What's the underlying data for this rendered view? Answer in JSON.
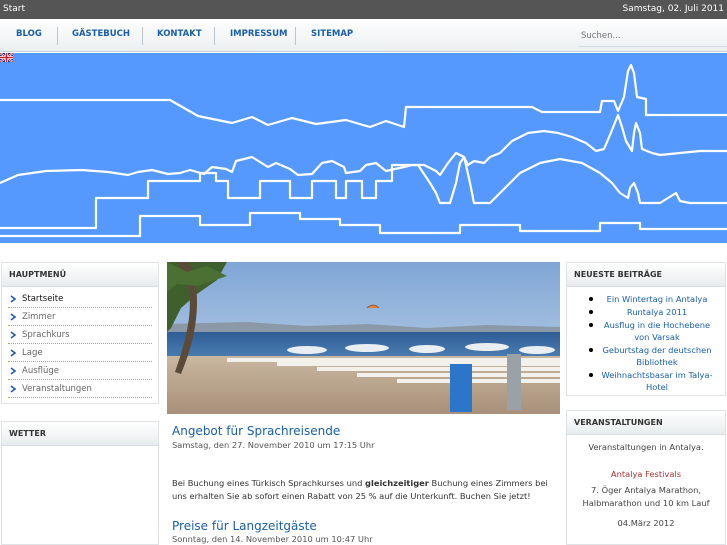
{
  "topbar": {
    "breadcrumb": "Start",
    "date": "Samstag, 02. Juli 2011"
  },
  "nav": {
    "items": [
      "BLOG",
      "GÄSTEBUCH",
      "KONTAKT",
      "IMPRESSUM",
      "SITEMAP"
    ],
    "search_placeholder": "Suchen..."
  },
  "colors": {
    "banner": "#5599ff",
    "link": "#1a5fa8",
    "accent_green": "#8fbf4a",
    "event_link": "#aa3333"
  },
  "languages": [
    "de-flag-icon",
    "uk-flag-icon"
  ],
  "main_menu": {
    "title": "HAUPTMENÜ",
    "items": [
      "Startseite",
      "Zimmer",
      "Sprachkurs",
      "Lage",
      "Ausflüge",
      "Veranstaltungen"
    ],
    "active": "Startseite"
  },
  "weather": {
    "title": "WETTER"
  },
  "recent_posts": {
    "title": "NEUESTE BEITRÄGE",
    "items": [
      "Ein Wintertag in Antalya",
      "Runtalya 2011",
      "Ausflug in die Hochebene von Varsak",
      "Geburtstag der deutschen Bibliothek",
      "Weihnachtsbasar im Talya-Hotel"
    ]
  },
  "events": {
    "title": "VERANSTALTUNGEN",
    "intro": "Veranstaltungen in Antalya.",
    "link": "Antalya Festivals",
    "event": "7. Öger Antalya Marathon, Halbmarathon und 10 km Lauf",
    "event_date": "04.März 2012"
  },
  "posts": [
    {
      "title": "Angebot für Sprachreisende",
      "meta": "Samstag, den 27. November 2010 um 17:15 Uhr",
      "body_pre": "Bei Buchung eines Türkisch Sprachkurses und ",
      "body_bold": "gleichzeitiger",
      "body_post": " Buchung eines Zimmers bei uns erhalten Sie ab sofort einen Rabatt von 25 % auf die Unterkunft. Buchen Sie jetzt!"
    },
    {
      "title": "Preise für Langzeitgäste",
      "meta": "Sonntag, den 14. November 2010 um 10:47 Uhr"
    }
  ]
}
